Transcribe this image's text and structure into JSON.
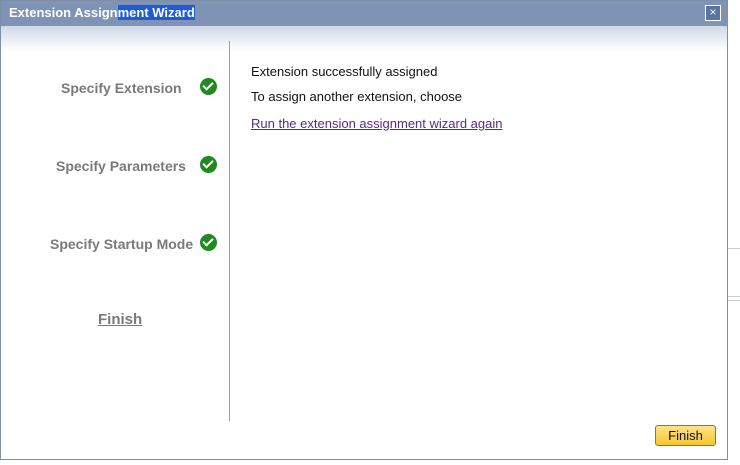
{
  "dialog": {
    "title_prefix": "Extension Assign",
    "title_selected": "ment Wizard",
    "close_symbol": "×"
  },
  "steps": [
    {
      "label": "Specify Extension",
      "done": true
    },
    {
      "label": "Specify Parameters",
      "done": true
    },
    {
      "label": "Specify Startup Mode",
      "done": true
    }
  ],
  "finish_step_label": "Finish",
  "content": {
    "success_text": "Extension successfully assigned",
    "instruction_text": "To assign another extension, choose",
    "rerun_link": "Run the extension assignment wizard again"
  },
  "footer": {
    "finish_button": "Finish"
  },
  "colors": {
    "title_bar": "#7f93b5",
    "check": "#1f8a1f",
    "button_gold": "#f4c632",
    "link": "#5a2a8a"
  }
}
